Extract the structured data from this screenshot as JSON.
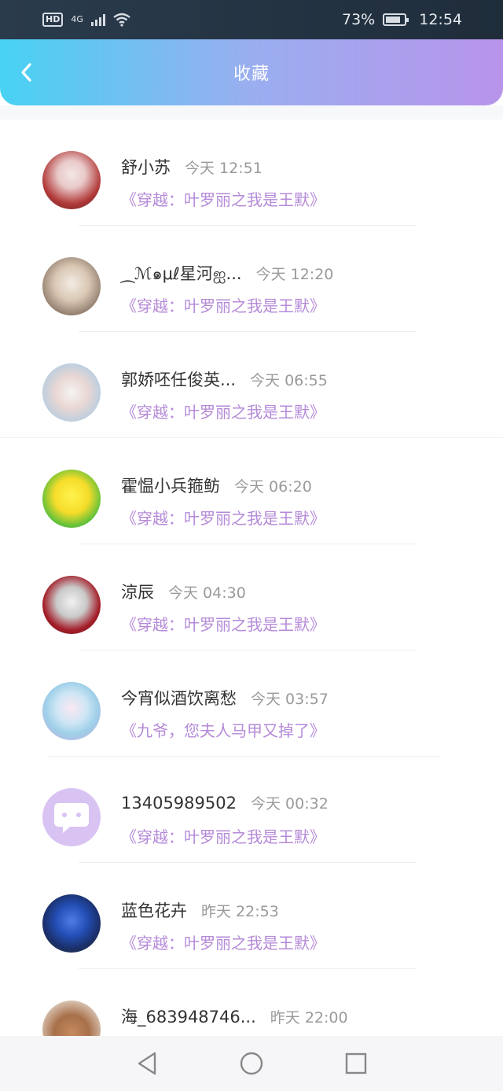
{
  "status_bar": {
    "hd": "HD",
    "network": "4G",
    "battery_percent": "73%",
    "time": "12:54"
  },
  "header": {
    "title": "收藏"
  },
  "items": [
    {
      "name": "舒小苏",
      "time": "今天 12:51",
      "book": "《穿越：叶罗丽之我是王默》"
    },
    {
      "name": "⁔ℳ๑μℓ星河ஐ...",
      "time": "今天 12:20",
      "book": "《穿越：叶罗丽之我是王默》"
    },
    {
      "name": "郭娇呸任俊英...",
      "time": "今天 06:55",
      "book": "《穿越：叶罗丽之我是王默》"
    },
    {
      "name": "霍愠小兵箍鲂",
      "time": "今天 06:20",
      "book": "《穿越：叶罗丽之我是王默》"
    },
    {
      "name": "涼辰",
      "time": "今天 04:30",
      "book": "《穿越：叶罗丽之我是王默》"
    },
    {
      "name": "今宵似酒饮离愁",
      "time": "今天 03:57",
      "book": "《九爷，您夫人马甲又掉了》"
    },
    {
      "name": "13405989502",
      "time": "今天 00:32",
      "book": "《穿越：叶罗丽之我是王默》"
    },
    {
      "name": "蓝色花卉",
      "time": "昨天 22:53",
      "book": "《穿越：叶罗丽之我是王默》"
    },
    {
      "name": "海_683948746...",
      "time": "昨天 22:00",
      "book": ""
    }
  ],
  "colors": {
    "header_start": "#47d2f3",
    "header_end": "#b894ea",
    "book_title": "#b58ad8"
  },
  "icons": {
    "back": "chevron-left-icon",
    "nav_back": "triangle-back-icon",
    "nav_home": "circle-home-icon",
    "nav_recent": "square-recent-icon"
  }
}
